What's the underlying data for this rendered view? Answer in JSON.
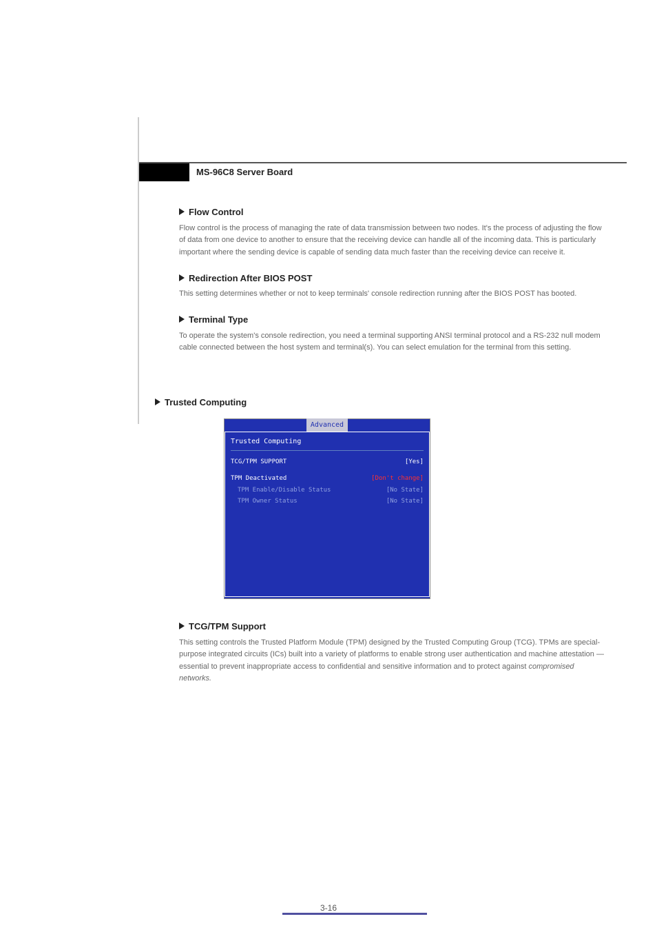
{
  "header": {
    "title": "MS-96C8 Server Board"
  },
  "items_inner": [
    {
      "heading": "Flow Control",
      "desc": "Flow control is the process of managing the rate of data transmission between two nodes. It's the process of adjusting the flow of data from one device to another to ensure that the receiving device can handle all of the incoming data. This is particularly important where the sending device is capable of sending data much faster than the receiving device can receive it."
    },
    {
      "heading": "Redirection After BIOS POST",
      "desc": "This setting determines whether or not to keep terminals' console redirection running after the BIOS POST has booted."
    },
    {
      "heading": "Terminal Type",
      "desc": "To operate the system's console redirection, you need a terminal supporting ANSI terminal protocol and a RS-232 null modem cable connected between the host system and terminal(s). You can select emulation for the terminal from this setting."
    }
  ],
  "section_heading": "Trusted Computing",
  "bios": {
    "tab": "Advanced",
    "title": "Trusted Computing",
    "rows": [
      {
        "label": "TCG/TPM SUPPORT",
        "value": "[Yes]",
        "highlight": true
      },
      {
        "label": "TPM Deactivated",
        "value": "[Don't change]",
        "selected": true
      },
      {
        "label": "TPM Enable/Disable Status",
        "value": "[No State]",
        "indent": true
      },
      {
        "label": "TPM Owner Status",
        "value": "[No State]",
        "indent": true
      }
    ]
  },
  "tcg": {
    "heading": "TCG/TPM Support",
    "desc_part1": "This setting controls the Trusted Platform Module (TPM) designed by the Trusted Computing Group (TCG). TPMs are special-purpose integrated circuits (ICs) built into a variety of platforms to enable strong user authentication and machine attestation — essential to prevent inappropriate access to confidential and sensitive information and to protect against ",
    "desc_part2": "compromised networks."
  },
  "page_number": "3-16"
}
